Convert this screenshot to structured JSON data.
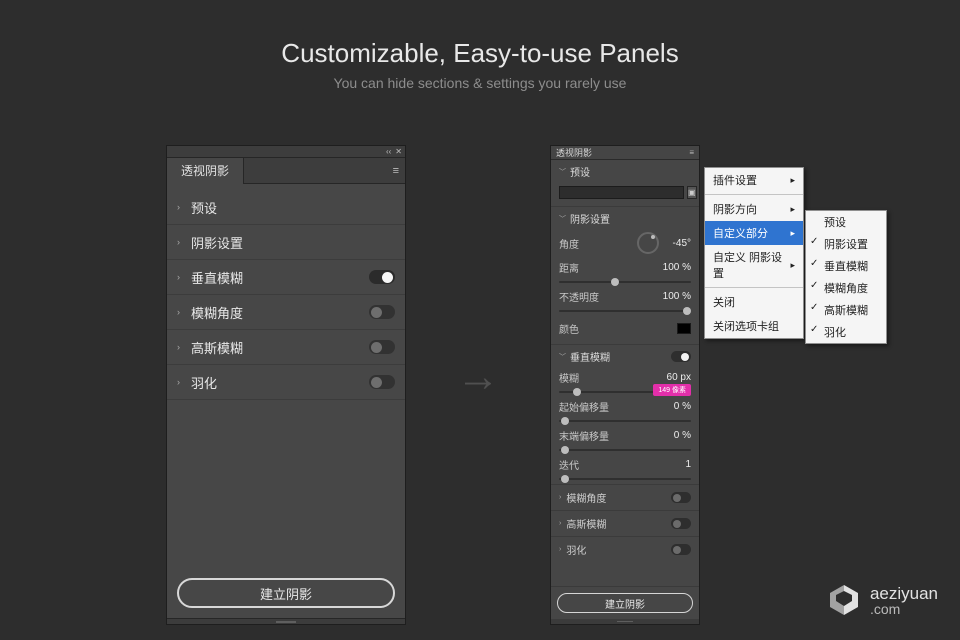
{
  "heading": {
    "title": "Customizable, Easy-to-use Panels",
    "subtitle": "You can hide sections & settings you rarely use"
  },
  "left_panel": {
    "tab": "透视阴影",
    "rows": [
      {
        "label": "预设",
        "toggle": null
      },
      {
        "label": "阴影设置",
        "toggle": null
      },
      {
        "label": "垂直模糊",
        "toggle": "on"
      },
      {
        "label": "模糊角度",
        "toggle": "off"
      },
      {
        "label": "高斯模糊",
        "toggle": "off"
      },
      {
        "label": "羽化",
        "toggle": "off"
      }
    ],
    "button": "建立阴影"
  },
  "right_panel": {
    "tab": "透视阴影",
    "preset_header": "预设",
    "shadow_settings": {
      "header": "阴影设置",
      "angle": {
        "label": "角度",
        "value": "-45°"
      },
      "distance": {
        "label": "距离",
        "value": "100 %"
      },
      "opacity": {
        "label": "不透明度",
        "value": "100 %"
      },
      "color": {
        "label": "颜色"
      }
    },
    "vertical_blur": {
      "header": "垂直模糊",
      "blur": {
        "label": "模糊",
        "value": "60 px"
      },
      "tag": "149 像素",
      "start_offset": {
        "label": "起始偏移量",
        "value": "0 %"
      },
      "end_offset": {
        "label": "末端偏移量",
        "value": "0 %"
      },
      "iterations": {
        "label": "迭代",
        "value": "1"
      }
    },
    "collapsed": [
      {
        "label": "模糊角度",
        "toggle": "off"
      },
      {
        "label": "高斯模糊",
        "toggle": "off"
      },
      {
        "label": "羽化",
        "toggle": "off"
      }
    ],
    "button": "建立阴影"
  },
  "menu1": {
    "items": [
      {
        "label": "插件设置",
        "sub": true
      },
      {
        "sep": true
      },
      {
        "label": "阴影方向",
        "sub": true
      },
      {
        "label": "自定义部分",
        "sub": true,
        "selected": true
      },
      {
        "label": "自定义 阴影设置",
        "sub": true
      },
      {
        "sep": true
      },
      {
        "label": "关闭"
      },
      {
        "label": "关闭选项卡组"
      }
    ]
  },
  "menu2": {
    "items": [
      {
        "label": "预设",
        "checked": false
      },
      {
        "label": "阴影设置",
        "checked": true
      },
      {
        "label": "垂直模糊",
        "checked": true
      },
      {
        "label": "模糊角度",
        "checked": true
      },
      {
        "label": "高斯模糊",
        "checked": true
      },
      {
        "label": "羽化",
        "checked": true
      }
    ]
  },
  "logo": {
    "brand": "aeziyuan",
    "domain": ".com"
  }
}
